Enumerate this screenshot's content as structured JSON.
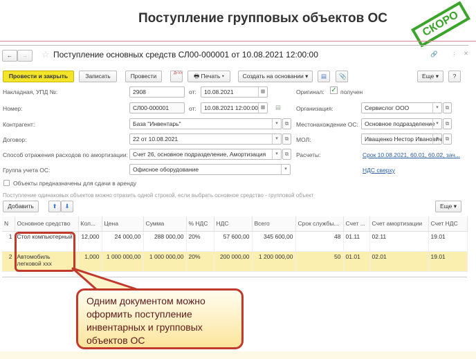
{
  "slide": {
    "title": "Поступление групповых объектов ОС",
    "stamp": "СКОРО"
  },
  "window": {
    "title": "Поступление основных средств СЛ00-000001 от 10.08.2021 12:00:00"
  },
  "toolbar": {
    "post_close": "Провести и закрыть",
    "save": "Записать",
    "post": "Провести",
    "dtkt": "Дт Кт",
    "print": "Печать",
    "create_based": "Создать на основании",
    "more": "Еще",
    "help": "?"
  },
  "form": {
    "invoice_label": "Накладная, УПД №:",
    "invoice_no": "2908",
    "from": "от:",
    "invoice_date": "10.08.2021",
    "number_label": "Номер:",
    "number": "СЛ00-000001",
    "number_date": "10.08.2021 12:00:00",
    "contractor_label": "Контрагент:",
    "contractor": "База \"Инвентарь\"",
    "contract_label": "Договор:",
    "contract": "22 от 10.08.2021",
    "amort_label": "Способ отражения расходов по амортизации:",
    "amort": "Счет 26, основное подразделение, Амортизация",
    "group_label": "Группа учета ОС:",
    "group": "Офисное оборудование",
    "rent_label": "Объекты предназначены для сдачи в аренду",
    "original_label": "Оригинал:",
    "original_value": "получен",
    "org_label": "Организация:",
    "org": "Сервислог ООО",
    "location_label": "Местонахождение ОС:",
    "location": "Основное подразделение",
    "mol_label": "МОЛ:",
    "mol": "Иващенко Нестор Иванович",
    "settlements_label": "Расчеты:",
    "settlements": "Срок 10.08.2021, 60.01, 60.02, зач...",
    "vat_link": "НДС сверху",
    "hint": "Поступление одинаковых объектов можно отразить одной строкой, если выбрать основное средство - групповой объект"
  },
  "table_toolbar": {
    "add": "Добавить",
    "more": "Еще"
  },
  "table": {
    "headers": [
      "N",
      "Основное средство",
      "Кол...",
      "Цена",
      "Сумма",
      "% НДС",
      "НДС",
      "Всего",
      "Срок службы...",
      "Счет ...",
      "Счет амортизации",
      "Счет НДС"
    ],
    "rows": [
      [
        "1",
        "Стол компьютерный",
        "12,000",
        "24 000,00",
        "288 000,00",
        "20%",
        "57 600,00",
        "345 600,00",
        "48",
        "01.11",
        "02.11",
        "19.01"
      ],
      [
        "2",
        "Автомобиль легковой ххх",
        "1,000",
        "1 000 000,00",
        "1 000 000,00",
        "20%",
        "200 000,00",
        "1 200 000,00",
        "50",
        "01.01",
        "02.01",
        "19.01"
      ]
    ]
  },
  "callout": "Одним документом можно оформить поступление инвентарных и групповых объектов ОС"
}
